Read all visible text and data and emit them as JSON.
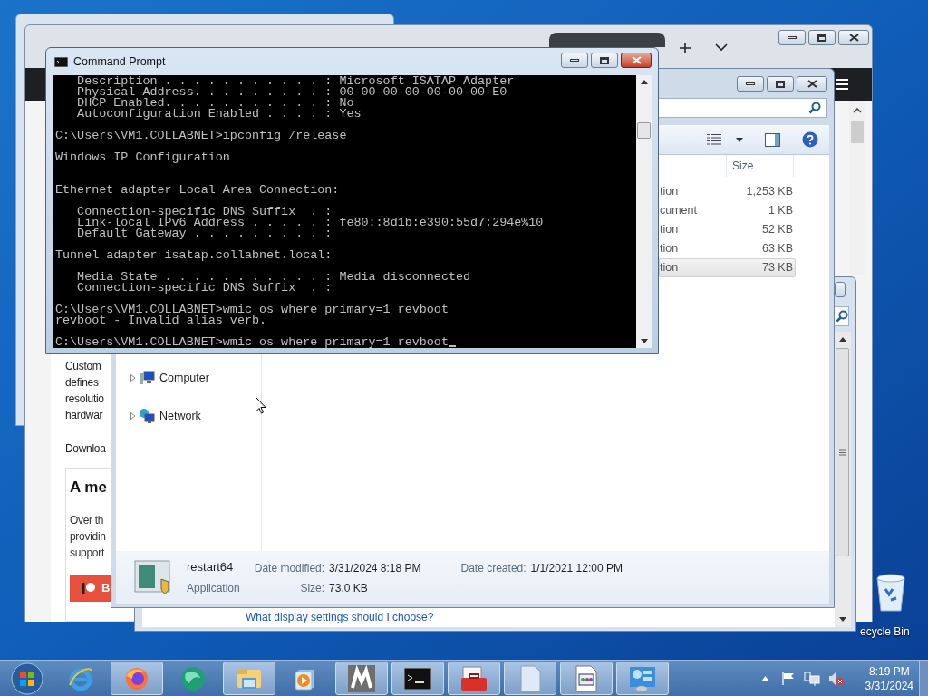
{
  "browser": {
    "article_lines": [
      "Custom",
      "defines",
      "resolutio",
      "hardwar"
    ],
    "download_text": "Downloa",
    "card": {
      "heading": "A me",
      "lines": [
        "Over th",
        "providin",
        "support"
      ],
      "button_label": "B"
    }
  },
  "display_window": {
    "link": "What display settings should I choose?"
  },
  "explorer": {
    "columns": [
      {
        "label": "Size"
      }
    ],
    "rows": [
      {
        "type": "tion",
        "size": "1,253 KB",
        "selected": false
      },
      {
        "type": "cument",
        "size": "1 KB",
        "selected": false
      },
      {
        "type": "tion",
        "size": "52 KB",
        "selected": false
      },
      {
        "type": "tion",
        "size": "63 KB",
        "selected": false
      },
      {
        "type": "tion",
        "size": "73 KB",
        "selected": true
      }
    ],
    "nav": [
      {
        "kind": "computer",
        "label": "Computer"
      },
      {
        "kind": "network",
        "label": "Network"
      }
    ],
    "details": {
      "name": "restart64",
      "type": "Application",
      "modified_label": "Date modified:",
      "modified": "3/31/2024 8:18 PM",
      "size_label": "Size:",
      "size": "73.0 KB",
      "created_label": "Date created:",
      "created": "1/1/2021 12:00 PM"
    }
  },
  "cmd": {
    "title": "Command Prompt",
    "lines": [
      {
        "kind": "text",
        "text": "   Description . . . . . . . . . . . : Microsoft ISATAP Adapter"
      },
      {
        "kind": "text",
        "text": "   Physical Address. . . . . . . . . : 00-00-00-00-00-00-00-E0"
      },
      {
        "kind": "text",
        "text": "   DHCP Enabled. . . . . . . . . . . : No"
      },
      {
        "kind": "text",
        "text": "   Autoconfiguration Enabled . . . . : Yes"
      },
      {
        "kind": "blank"
      },
      {
        "kind": "text",
        "text": "C:\\Users\\VM1.COLLABNET>ipconfig /release"
      },
      {
        "kind": "blank"
      },
      {
        "kind": "text",
        "text": "Windows IP Configuration"
      },
      {
        "kind": "blank"
      },
      {
        "kind": "blank"
      },
      {
        "kind": "text",
        "text": "Ethernet adapter Local Area Connection:"
      },
      {
        "kind": "blank"
      },
      {
        "kind": "text",
        "text": "   Connection-specific DNS Suffix  . :"
      },
      {
        "kind": "text",
        "text": "   Link-local IPv6 Address . . . . . : fe80::8d1b:e390:55d7:294e%10"
      },
      {
        "kind": "text",
        "text": "   Default Gateway . . . . . . . . . :"
      },
      {
        "kind": "blank"
      },
      {
        "kind": "text",
        "text": "Tunnel adapter isatap.collabnet.local:"
      },
      {
        "kind": "blank"
      },
      {
        "kind": "text",
        "text": "   Media State . . . . . . . . . . . : Media disconnected"
      },
      {
        "kind": "text",
        "text": "   Connection-specific DNS Suffix  . :"
      },
      {
        "kind": "blank"
      },
      {
        "kind": "text",
        "text": "C:\\Users\\VM1.COLLABNET>wmic os where primary=1 revboot"
      },
      {
        "kind": "text",
        "text": "revboot - Invalid alias verb."
      },
      {
        "kind": "blank"
      },
      {
        "kind": "input",
        "text": "C:\\Users\\VM1.COLLABNET>wmic os where primary=1 revboot"
      }
    ]
  },
  "desktop": {
    "recycle_bin_label": "ecycle Bin"
  },
  "taskbar": {
    "apps": [
      {
        "kind": "ie",
        "running": false
      },
      {
        "kind": "firefox",
        "running": true
      },
      {
        "kind": "globe",
        "running": false
      },
      {
        "kind": "folder",
        "running": true
      },
      {
        "kind": "media",
        "running": false
      },
      {
        "kind": "m",
        "running": true
      },
      {
        "kind": "console",
        "running": true
      },
      {
        "kind": "toolbox",
        "running": true
      },
      {
        "kind": "page",
        "running": true
      },
      {
        "kind": "document",
        "running": true
      },
      {
        "kind": "panel",
        "running": true
      }
    ],
    "clock": {
      "time": "8:19 PM",
      "date": "3/31/2024"
    }
  }
}
